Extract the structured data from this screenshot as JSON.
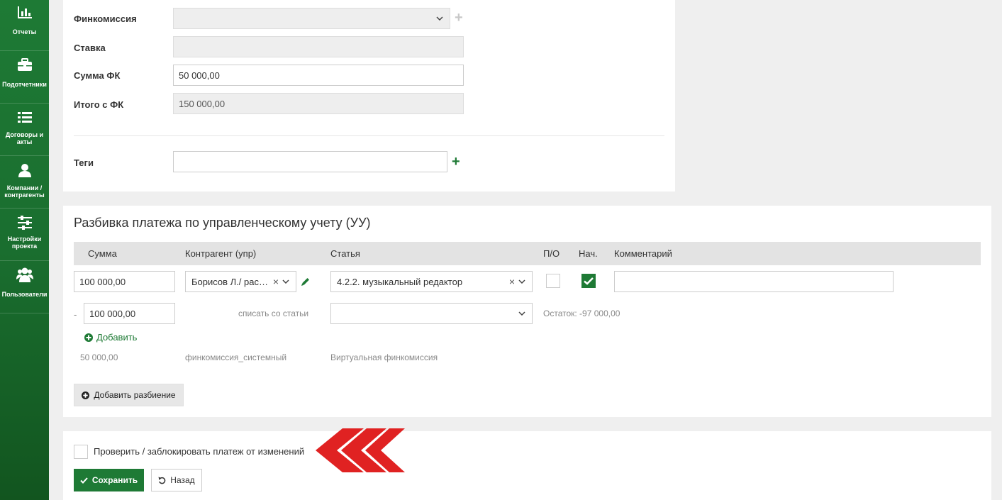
{
  "sidebar": {
    "items": [
      {
        "label": "Отчеты",
        "icon": "bar-chart-icon"
      },
      {
        "label": "Подотчетники",
        "icon": "briefcase-icon"
      },
      {
        "label": "Договоры и акты",
        "icon": "list-icon"
      },
      {
        "label": "Компании / контрагенты",
        "icon": "user-icon"
      },
      {
        "label": "Настройки проекта",
        "icon": "sliders-icon"
      },
      {
        "label": "Пользователи",
        "icon": "users-icon"
      }
    ]
  },
  "form": {
    "fincommission_label": "Финкомиссия",
    "fincommission_value": "",
    "rate_label": "Ставка",
    "rate_value": "",
    "fk_sum_label": "Сумма ФК",
    "fk_sum_value": "50 000,00",
    "total_label": "Итого с ФК",
    "total_value": "150 000,00",
    "tags_label": "Теги",
    "tags_value": ""
  },
  "breakdown": {
    "title": "Разбивка платежа по управленческому учету (УУ)",
    "columns": {
      "sum": "Сумма",
      "counterparty": "Контрагент (упр)",
      "article": "Статья",
      "po": "П/О",
      "nach": "Нач.",
      "comment": "Комментарий"
    },
    "row": {
      "sum": "100 000,00",
      "counterparty": "Борисов Л./ рас…",
      "article": "4.2.2. музыкальный редактор",
      "po_checked": false,
      "nach_checked": true,
      "comment": ""
    },
    "writeoff": {
      "dash": "-",
      "sum": "100 000,00",
      "label": "списать со статьи",
      "article": "",
      "remainder": "Остаток: -97 000,00"
    },
    "add_label": "Добавить",
    "virtual": {
      "sum": "50 000,00",
      "counterparty": "финкомиссия_системный",
      "article": "Виртуальная финкомиссия"
    },
    "add_split_label": "Добавить разбиение"
  },
  "footer": {
    "lock_label": "Проверить / заблокировать платеж от изменений",
    "save_label": "Сохранить",
    "back_label": "Назад"
  },
  "colors": {
    "accent": "#1e7a35",
    "arrow": "#e02222"
  }
}
